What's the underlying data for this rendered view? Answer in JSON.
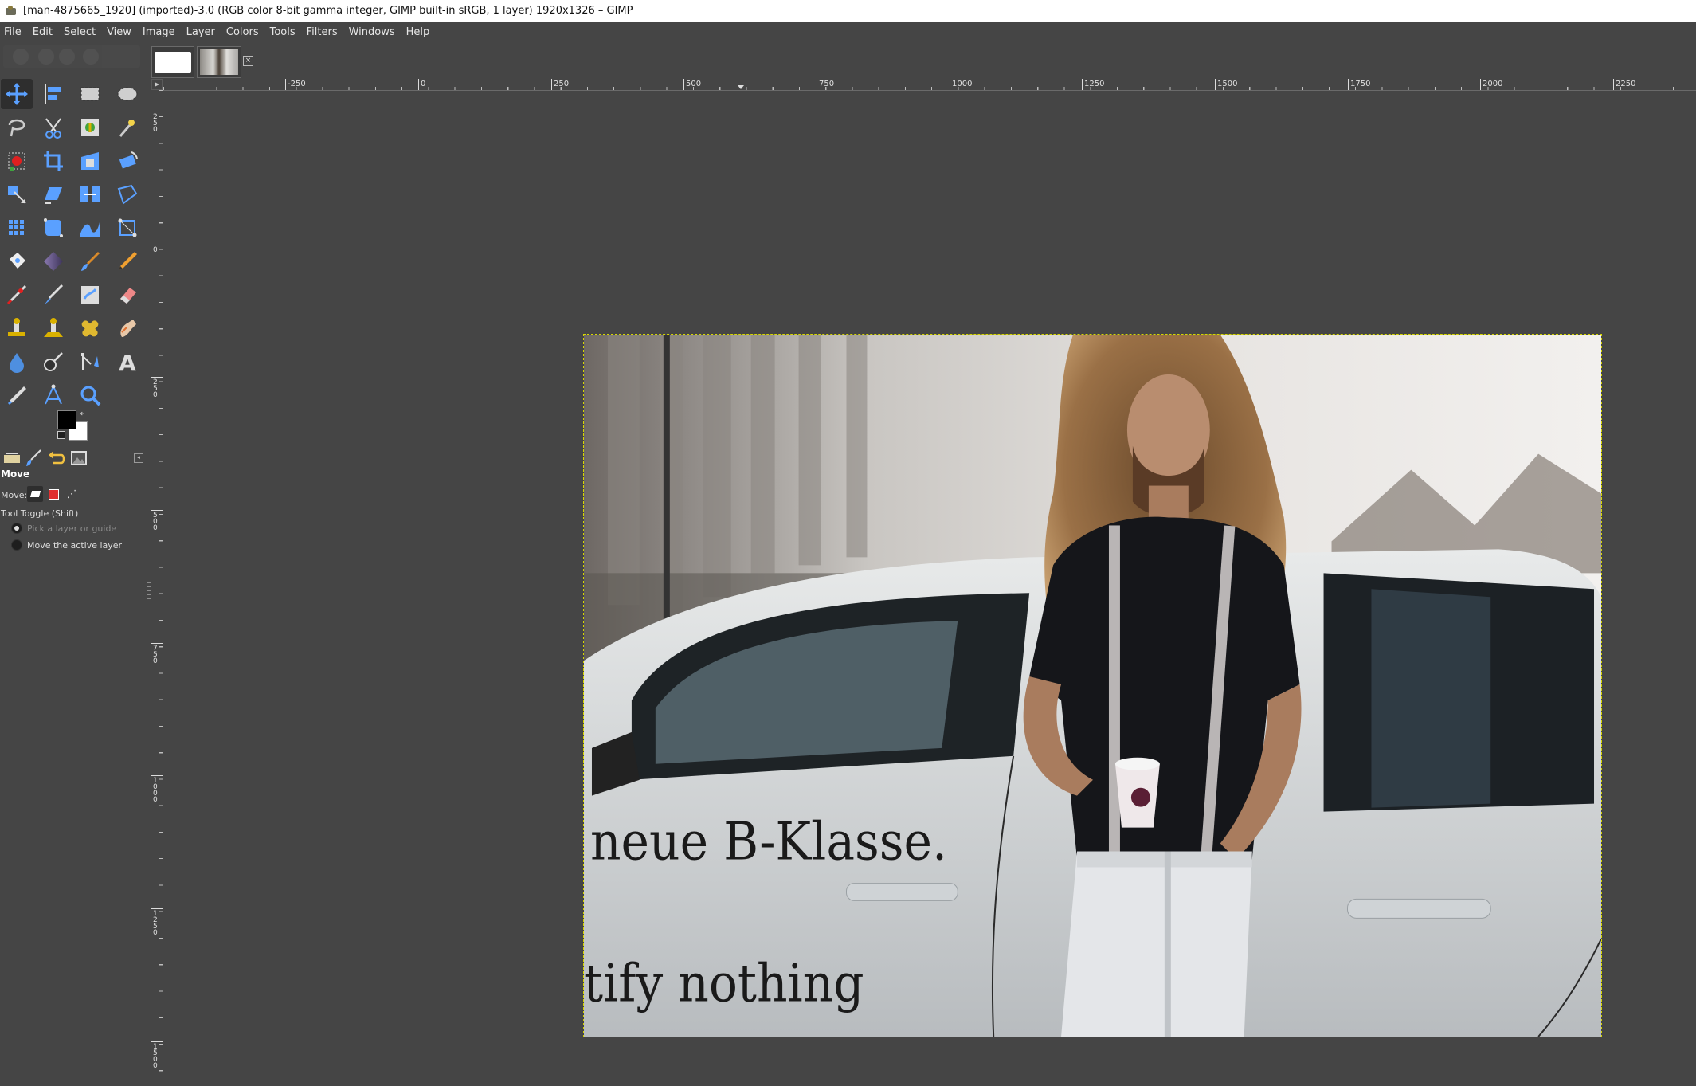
{
  "window": {
    "title": "[man-4875665_1920] (imported)-3.0 (RGB color 8-bit gamma integer, GIMP built-in sRGB, 1 layer) 1920x1326 – GIMP"
  },
  "menu": [
    "File",
    "Edit",
    "Select",
    "View",
    "Image",
    "Layer",
    "Colors",
    "Tools",
    "Filters",
    "Windows",
    "Help"
  ],
  "image_tabs": [
    {
      "name": "untitled-blank"
    },
    {
      "name": "man-4875665_1920"
    }
  ],
  "tools": [
    "move-tool",
    "align-tool",
    "rect-select-tool",
    "ellipse-select-tool",
    "free-select-tool",
    "scissors-select-tool",
    "foreground-select-tool",
    "fuzzy-select-tool",
    "by-color-select-tool",
    "crop-tool",
    "unified-transform-tool",
    "rotate-tool",
    "scale-tool",
    "shear-tool",
    "flip-tool",
    "perspective-tool",
    "cage-transform-tool",
    "warp-transform-tool",
    "wave-tool",
    "handle-transform-tool",
    "bucket-fill-tool",
    "gradient-tool",
    "paintbrush-tool",
    "pencil-tool",
    "airbrush-tool",
    "ink-tool",
    "mypaint-brush-tool",
    "eraser-tool",
    "clone-tool",
    "perspective-clone-tool",
    "heal-tool",
    "smudge-tool",
    "blur-tool",
    "dodge-burn-tool",
    "paths-tool",
    "text-tool",
    "color-picker-tool",
    "measure-tool",
    "zoom-tool"
  ],
  "colors": {
    "foreground": "#000000",
    "background": "#ffffff",
    "selection_border": "#d6d600",
    "canvas_bg": "#454545"
  },
  "tool_options": {
    "title": "Move",
    "move_label": "Move:",
    "toggle_label": "Tool Toggle  (Shift)",
    "options": [
      {
        "label": "Pick a layer or guide",
        "checked": true
      },
      {
        "label": "Move the active layer",
        "checked": false
      }
    ]
  },
  "rulers": {
    "horizontal_labels": [
      "-250",
      "0",
      "250",
      "500",
      "750",
      "1000",
      "1250",
      "1500",
      "1750",
      "2000",
      "2250"
    ],
    "vertical_labels": [
      "250",
      "0",
      "250",
      "500",
      "750",
      "1000",
      "1250",
      "1500"
    ]
  },
  "photo": {
    "text_line_1": "neue B-Klasse.",
    "text_line_2": "tify nothing"
  }
}
